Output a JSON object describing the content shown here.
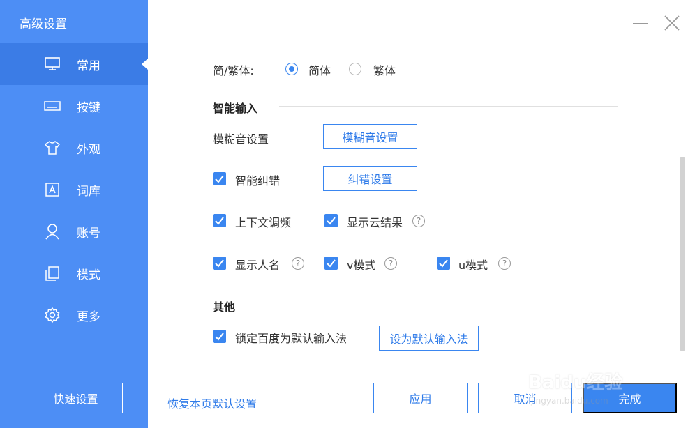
{
  "sidebar": {
    "title": "高级设置",
    "items": [
      {
        "label": "常用",
        "icon": "monitor-icon"
      },
      {
        "label": "按键",
        "icon": "keyboard-icon"
      },
      {
        "label": "外观",
        "icon": "shirt-icon"
      },
      {
        "label": "词库",
        "icon": "dictionary-icon"
      },
      {
        "label": "账号",
        "icon": "user-icon"
      },
      {
        "label": "模式",
        "icon": "copy-icon"
      },
      {
        "label": "更多",
        "icon": "gear-icon"
      }
    ],
    "quick_settings": "快速设置"
  },
  "general": {
    "script_label": "简/繁体:",
    "simplified": "简体",
    "traditional": "繁体",
    "selected": "简体"
  },
  "smart_input": {
    "section_title": "智能输入",
    "fuzzy_label": "模糊音设置",
    "fuzzy_button": "模糊音设置",
    "autocorrect_label": "智能纠错",
    "autocorrect_button": "纠错设置",
    "context_freq": "上下文调频",
    "cloud_result": "显示云结果",
    "show_names": "显示人名",
    "v_mode": "v模式",
    "u_mode": "u模式",
    "help_glyph": "?"
  },
  "other": {
    "section_title": "其他",
    "lock_default": "锁定百度为默认输入法",
    "set_default_button": "设为默认输入法"
  },
  "footer": {
    "restore_defaults": "恢复本页默认设置",
    "apply": "应用",
    "cancel": "取消",
    "done": "完成"
  },
  "watermark": {
    "brand": "Baidu经验",
    "url": "jingyan.baidu.com"
  },
  "colors": {
    "sidebar": "#4d8ef5",
    "accent": "#3a86f0"
  }
}
